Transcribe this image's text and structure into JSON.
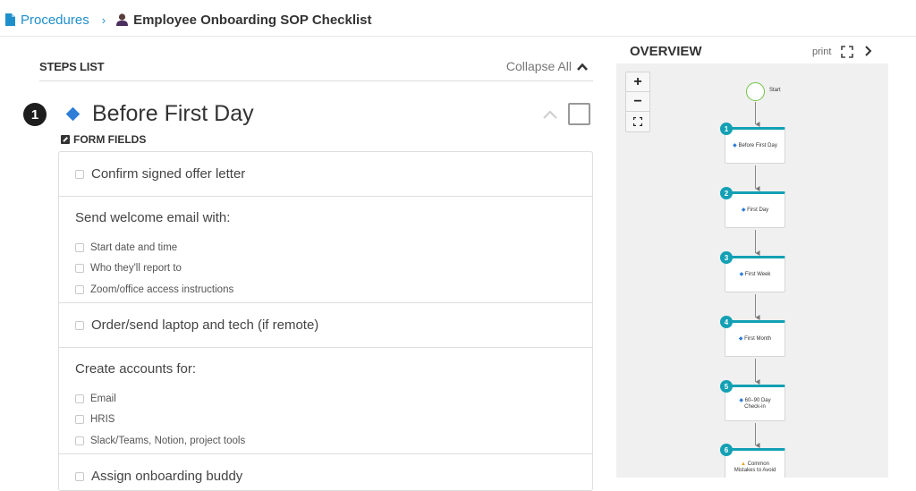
{
  "breadcrumb": {
    "parent": "Procedures",
    "current": "Employee Onboarding SOP Checklist",
    "parent_icon": "document-icon",
    "current_icon": "person-icon"
  },
  "steps_list": {
    "title": "STEPS LIST",
    "collapse_all": "Collapse All"
  },
  "step": {
    "number": "1",
    "title": "Before First Day",
    "form_fields_label": "FORM FIELDS",
    "fields": [
      {
        "type": "checkbox",
        "label": "Confirm signed offer letter"
      },
      {
        "type": "group",
        "label": "Send welcome email with:",
        "items": [
          "Start date and time",
          "Who they'll report to",
          "Zoom/office access instructions"
        ]
      },
      {
        "type": "checkbox",
        "label": "Order/send laptop and tech (if remote)"
      },
      {
        "type": "group",
        "label": "Create accounts for:",
        "items": [
          "Email",
          "HRIS",
          "Slack/Teams, Notion, project tools"
        ]
      },
      {
        "type": "checkbox",
        "label": "Assign onboarding buddy"
      }
    ]
  },
  "overview": {
    "title": "OVERVIEW",
    "print": "print",
    "zoom_in": "+",
    "zoom_out": "−",
    "start_label": "Start",
    "nodes": [
      {
        "num": "1",
        "label": "Before First Day",
        "icon": "diamond"
      },
      {
        "num": "2",
        "label": "First Day",
        "icon": "diamond"
      },
      {
        "num": "3",
        "label": "First Week",
        "icon": "diamond"
      },
      {
        "num": "4",
        "label": "First Month",
        "icon": "diamond"
      },
      {
        "num": "5",
        "label": "60–90 Day Check-in",
        "icon": "diamond"
      },
      {
        "num": "6",
        "label": "Common Mistakes to Avoid",
        "icon": "warning"
      }
    ]
  },
  "colors": {
    "link": "#1f8fcc",
    "accent_teal": "#13a0b4",
    "diamond_blue": "#2e7dd6",
    "start_green": "#6fc245"
  }
}
